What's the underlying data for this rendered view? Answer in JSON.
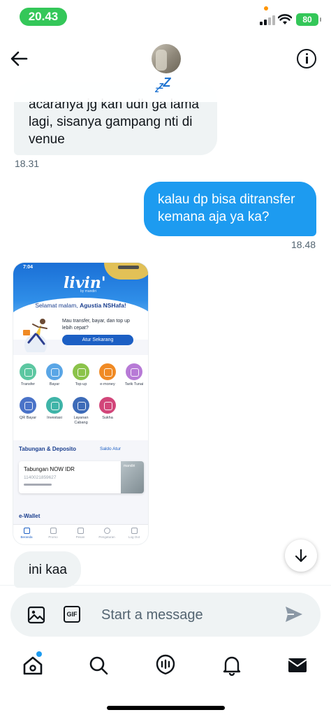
{
  "status_bar": {
    "time": "20.43",
    "battery": "80"
  },
  "header": {
    "sleep_badge": [
      "z",
      "z",
      "Z"
    ]
  },
  "messages": {
    "incoming_1": {
      "text": "acaranya jg kan udh ga lama\nlagi, sisanya gampang nti di\nvenue",
      "time": "18.31"
    },
    "outgoing_1": {
      "text": "kalau dp bisa ditransfer\nkemana aja ya ka?",
      "time": "18.48"
    },
    "incoming_2": {
      "text": "ini kaa"
    }
  },
  "attachment": {
    "time": "7:04",
    "logo": "livin'",
    "logo_sub": "by mandiri",
    "greeting": "Selamat malam, ",
    "greeting_name": "Agustia NSHafa!",
    "promo_text": "Mau transfer, bayar, dan top up lebih cepat?",
    "promo_button": "Atur Sekarang",
    "menu": [
      {
        "label": "Transfer",
        "color": "#5cc7a1"
      },
      {
        "label": "Bayar",
        "color": "#5aa6e6"
      },
      {
        "label": "Top-up",
        "color": "#8bc34a"
      },
      {
        "label": "e-money",
        "color": "#f08a24"
      },
      {
        "label": "Tarik Tunai",
        "color": "#b77ad6"
      },
      {
        "label": "QR Bayar",
        "color": "#4a73c8"
      },
      {
        "label": "Investasi",
        "color": "#3fb4a8"
      },
      {
        "label": "Layanan Cabang",
        "color": "#3d6bb8"
      },
      {
        "label": "Sukha",
        "color": "#d2467a"
      }
    ],
    "section_title": "Tabungan & Deposito",
    "section_actions": "Saldo   Atur",
    "account_name": "Tabungan NOW IDR",
    "account_number": "1140021859627",
    "card_brand": "mandiri",
    "ewallet_title": "e-Wallet",
    "nav": [
      "Beranda",
      "Promo",
      "Pesan",
      "Pengaturan",
      "Log Out"
    ]
  },
  "composer": {
    "placeholder": "Start a message",
    "gif_label": "GIF"
  },
  "tabs": [
    "home",
    "search",
    "spaces",
    "notifications",
    "messages"
  ],
  "colors": {
    "accent": "#1d9bf0",
    "incoming_bubble": "#eff3f4",
    "status_green": "#34c759"
  }
}
